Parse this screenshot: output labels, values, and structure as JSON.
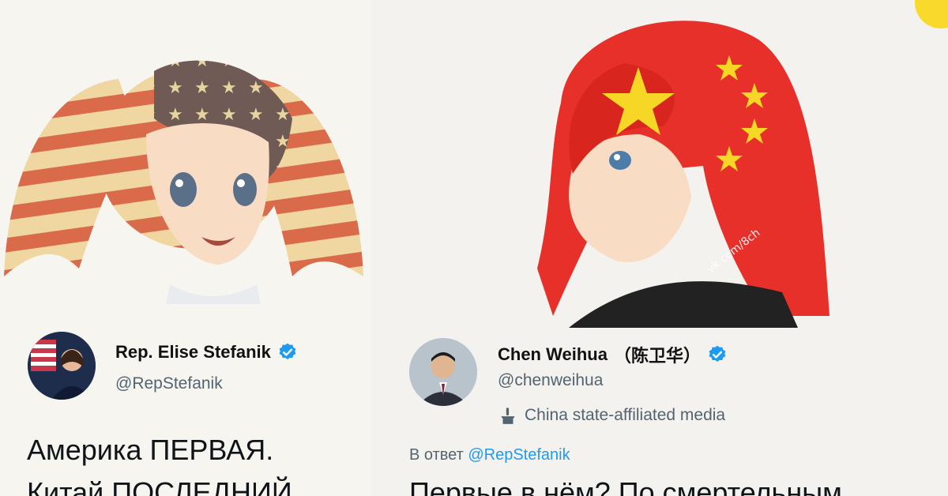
{
  "left_tweet": {
    "name": "Rep. Elise Stefanik",
    "handle": "@RepStefanik",
    "text_line1": "Америка ПЕРВАЯ.",
    "text_line2": "Китай ПОСЛЕДНИЙ"
  },
  "right_tweet": {
    "name": "Chen Weihua",
    "name_cn": "（陈卫华）",
    "handle": "@chenweihua",
    "affiliation": "China state-affiliated media",
    "reply_prefix": "В ответ",
    "reply_mention": "@RepStefanik",
    "text_line1": "Первые в нём? По смертельным"
  },
  "watermark": "vk.com/8ch",
  "icons": {
    "verified": "verified-badge-icon",
    "affiliation": "state-media-podium-icon"
  },
  "colors": {
    "verified_blue": "#1d9bf0",
    "china_red": "#e8302a",
    "star_yellow": "#f7d726",
    "accent_yellow": "#f8d92c"
  }
}
